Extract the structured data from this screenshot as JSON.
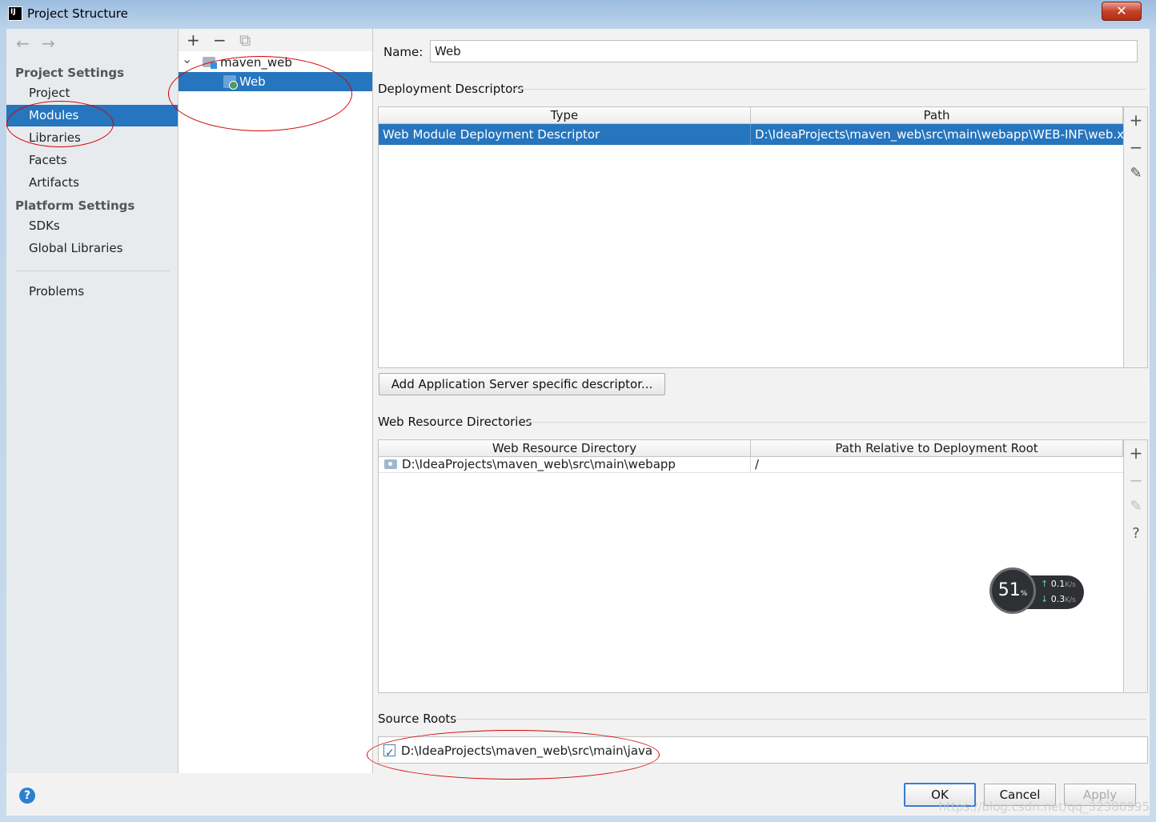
{
  "window": {
    "title": "Project Structure",
    "close": "✕"
  },
  "nav": {
    "back": "←",
    "forward": "→",
    "project_settings_title": "Project Settings",
    "project_settings": [
      "Project",
      "Modules",
      "Libraries",
      "Facets",
      "Artifacts"
    ],
    "platform_settings_title": "Platform Settings",
    "platform_settings": [
      "SDKs",
      "Global Libraries"
    ],
    "problems": "Problems",
    "selected": "Modules"
  },
  "tree": {
    "toolbar": {
      "add": "+",
      "remove": "−",
      "copy": "⧉"
    },
    "root": {
      "chevron": "⌄",
      "label": "maven_web"
    },
    "child": {
      "label": "Web"
    }
  },
  "detail": {
    "name_label": "Name:",
    "name_value": "Web",
    "deployment": {
      "title": "Deployment Descriptors",
      "columns": [
        "Type",
        "Path"
      ],
      "rows": [
        {
          "type": "Web Module Deployment Descriptor",
          "path": "D:\\IdeaProjects\\maven_web\\src\\main\\webapp\\WEB-INF\\web.xml"
        }
      ],
      "add_server_button": "Add Application Server specific descriptor..."
    },
    "web_resources": {
      "title": "Web Resource Directories",
      "columns": [
        "Web Resource Directory",
        "Path Relative to Deployment Root"
      ],
      "rows": [
        {
          "directory": "D:\\IdeaProjects\\maven_web\\src\\main\\webapp",
          "relative": "/"
        }
      ]
    },
    "source_roots": {
      "title": "Source Roots",
      "items": [
        {
          "path": "D:\\IdeaProjects\\maven_web\\src\\main\\java",
          "checked": true
        }
      ]
    },
    "side_toolbar": {
      "add": "+",
      "remove": "−",
      "edit": "✎",
      "help": "?"
    }
  },
  "footer": {
    "help": "?",
    "ok": "OK",
    "cancel": "Cancel",
    "apply": "Apply"
  },
  "overlay_widget": {
    "percent": "51",
    "percent_unit": "%",
    "up": "0.1",
    "down": "0.3",
    "unit": "K/s",
    "up_arrow": "↑",
    "down_arrow": "↓"
  },
  "watermark": "https://blog.csdn.net/qq_32380995"
}
